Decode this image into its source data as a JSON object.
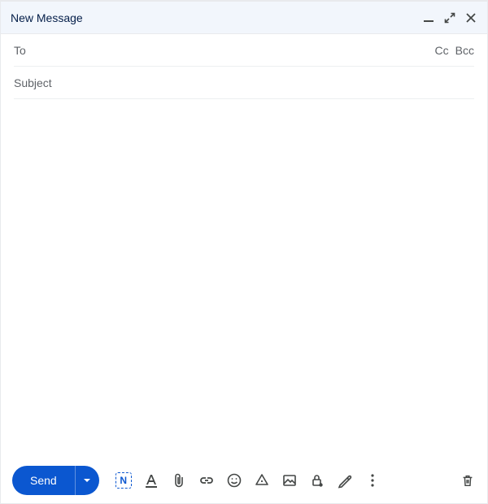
{
  "header": {
    "title": "New Message"
  },
  "fields": {
    "to_placeholder": "To",
    "to_value": "",
    "cc_label": "Cc",
    "bcc_label": "Bcc",
    "subject_placeholder": "Subject",
    "subject_value": ""
  },
  "body": {
    "value": ""
  },
  "toolbar": {
    "send_label": "Send",
    "spellcheck_glyph": "N"
  }
}
